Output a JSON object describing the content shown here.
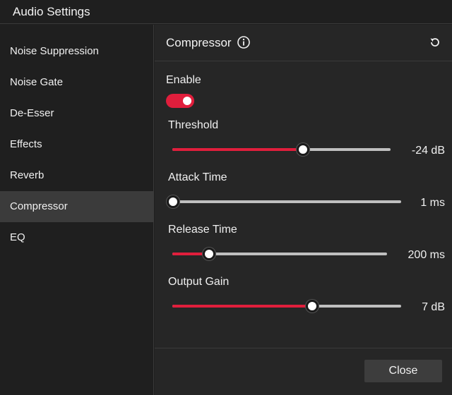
{
  "window": {
    "title": "Audio Settings"
  },
  "sidebar": {
    "items": [
      {
        "label": "Noise Suppression"
      },
      {
        "label": "Noise Gate"
      },
      {
        "label": "De-Esser"
      },
      {
        "label": "Effects"
      },
      {
        "label": "Reverb"
      },
      {
        "label": "Compressor",
        "selected": true
      },
      {
        "label": "EQ"
      }
    ]
  },
  "panel": {
    "title": "Compressor",
    "info_icon": "info-circle-icon",
    "reset_icon": "reset-icon",
    "enable": {
      "label": "Enable",
      "on": true
    },
    "controls": [
      {
        "label": "Threshold",
        "value_text": "-24 dB",
        "fraction": 0.6
      },
      {
        "label": "Attack Time",
        "value_text": "1 ms",
        "fraction": 0.0
      },
      {
        "label": "Release Time",
        "value_text": "200 ms",
        "fraction": 0.17
      },
      {
        "label": "Output Gain",
        "value_text": "7 dB",
        "fraction": 0.61
      }
    ]
  },
  "footer": {
    "close_label": "Close"
  },
  "colors": {
    "accent": "#e01e3c",
    "background": "#1f1f1f",
    "panel_background": "#262626",
    "selected_item": "#3b3b3b"
  }
}
